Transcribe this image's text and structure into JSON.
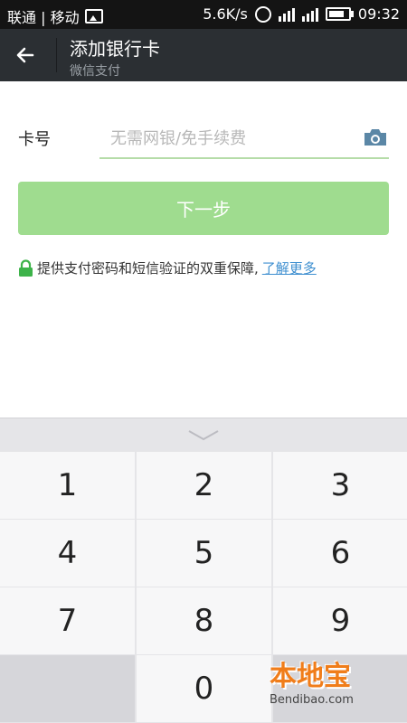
{
  "status_bar": {
    "carrier": "联通 | 移动",
    "speed": "5.6K/s",
    "time": "09:32"
  },
  "app_bar": {
    "title": "添加银行卡",
    "subtitle": "微信支付"
  },
  "card_form": {
    "label": "卡号",
    "placeholder": "无需网银/免手续费",
    "value": ""
  },
  "next_button": {
    "label": "下一步"
  },
  "security": {
    "text": "提供支付密码和短信验证的双重保障,",
    "link": "了解更多"
  },
  "keypad": {
    "keys": [
      "1",
      "2",
      "3",
      "4",
      "5",
      "6",
      "7",
      "8",
      "9",
      "",
      "0",
      ""
    ]
  },
  "watermark": {
    "main": "本地宝",
    "sub": "Bendibao.com"
  },
  "colors": {
    "accent_green": "#9fdc8f",
    "link_blue": "#3e8fd0",
    "app_bar": "#2b2f33"
  }
}
